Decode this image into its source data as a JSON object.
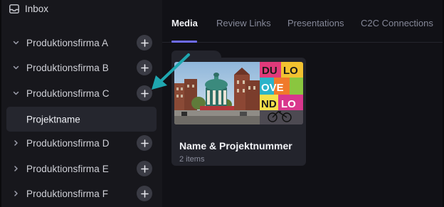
{
  "sidebar": {
    "inbox": {
      "label": "Inbox",
      "icon": "inbox-icon"
    },
    "folders": [
      {
        "label": "Produktionsfirma A",
        "expanded": true
      },
      {
        "label": "Produktionsfirma B",
        "expanded": true
      },
      {
        "label": "Produktionsfirma C",
        "expanded": true
      },
      {
        "label": "Produktionsfirma D",
        "expanded": false
      },
      {
        "label": "Produktionsfirma E",
        "expanded": false
      },
      {
        "label": "Produktionsfirma F",
        "expanded": false
      }
    ],
    "selected_project": {
      "label": "Projektname"
    }
  },
  "main": {
    "tabs": [
      {
        "label": "Media",
        "active": true
      },
      {
        "label": "Review Links",
        "active": false
      },
      {
        "label": "Presentations",
        "active": false
      },
      {
        "label": "C2C Connections",
        "active": false
      }
    ],
    "folder_card": {
      "title": "Name & Projektnummer",
      "count": "2 items"
    }
  },
  "colors": {
    "accent": "#6e6bf0",
    "annotation_arrow": "#1fa7b0",
    "sidebar_bg": "#17171c",
    "main_bg": "#111116"
  }
}
